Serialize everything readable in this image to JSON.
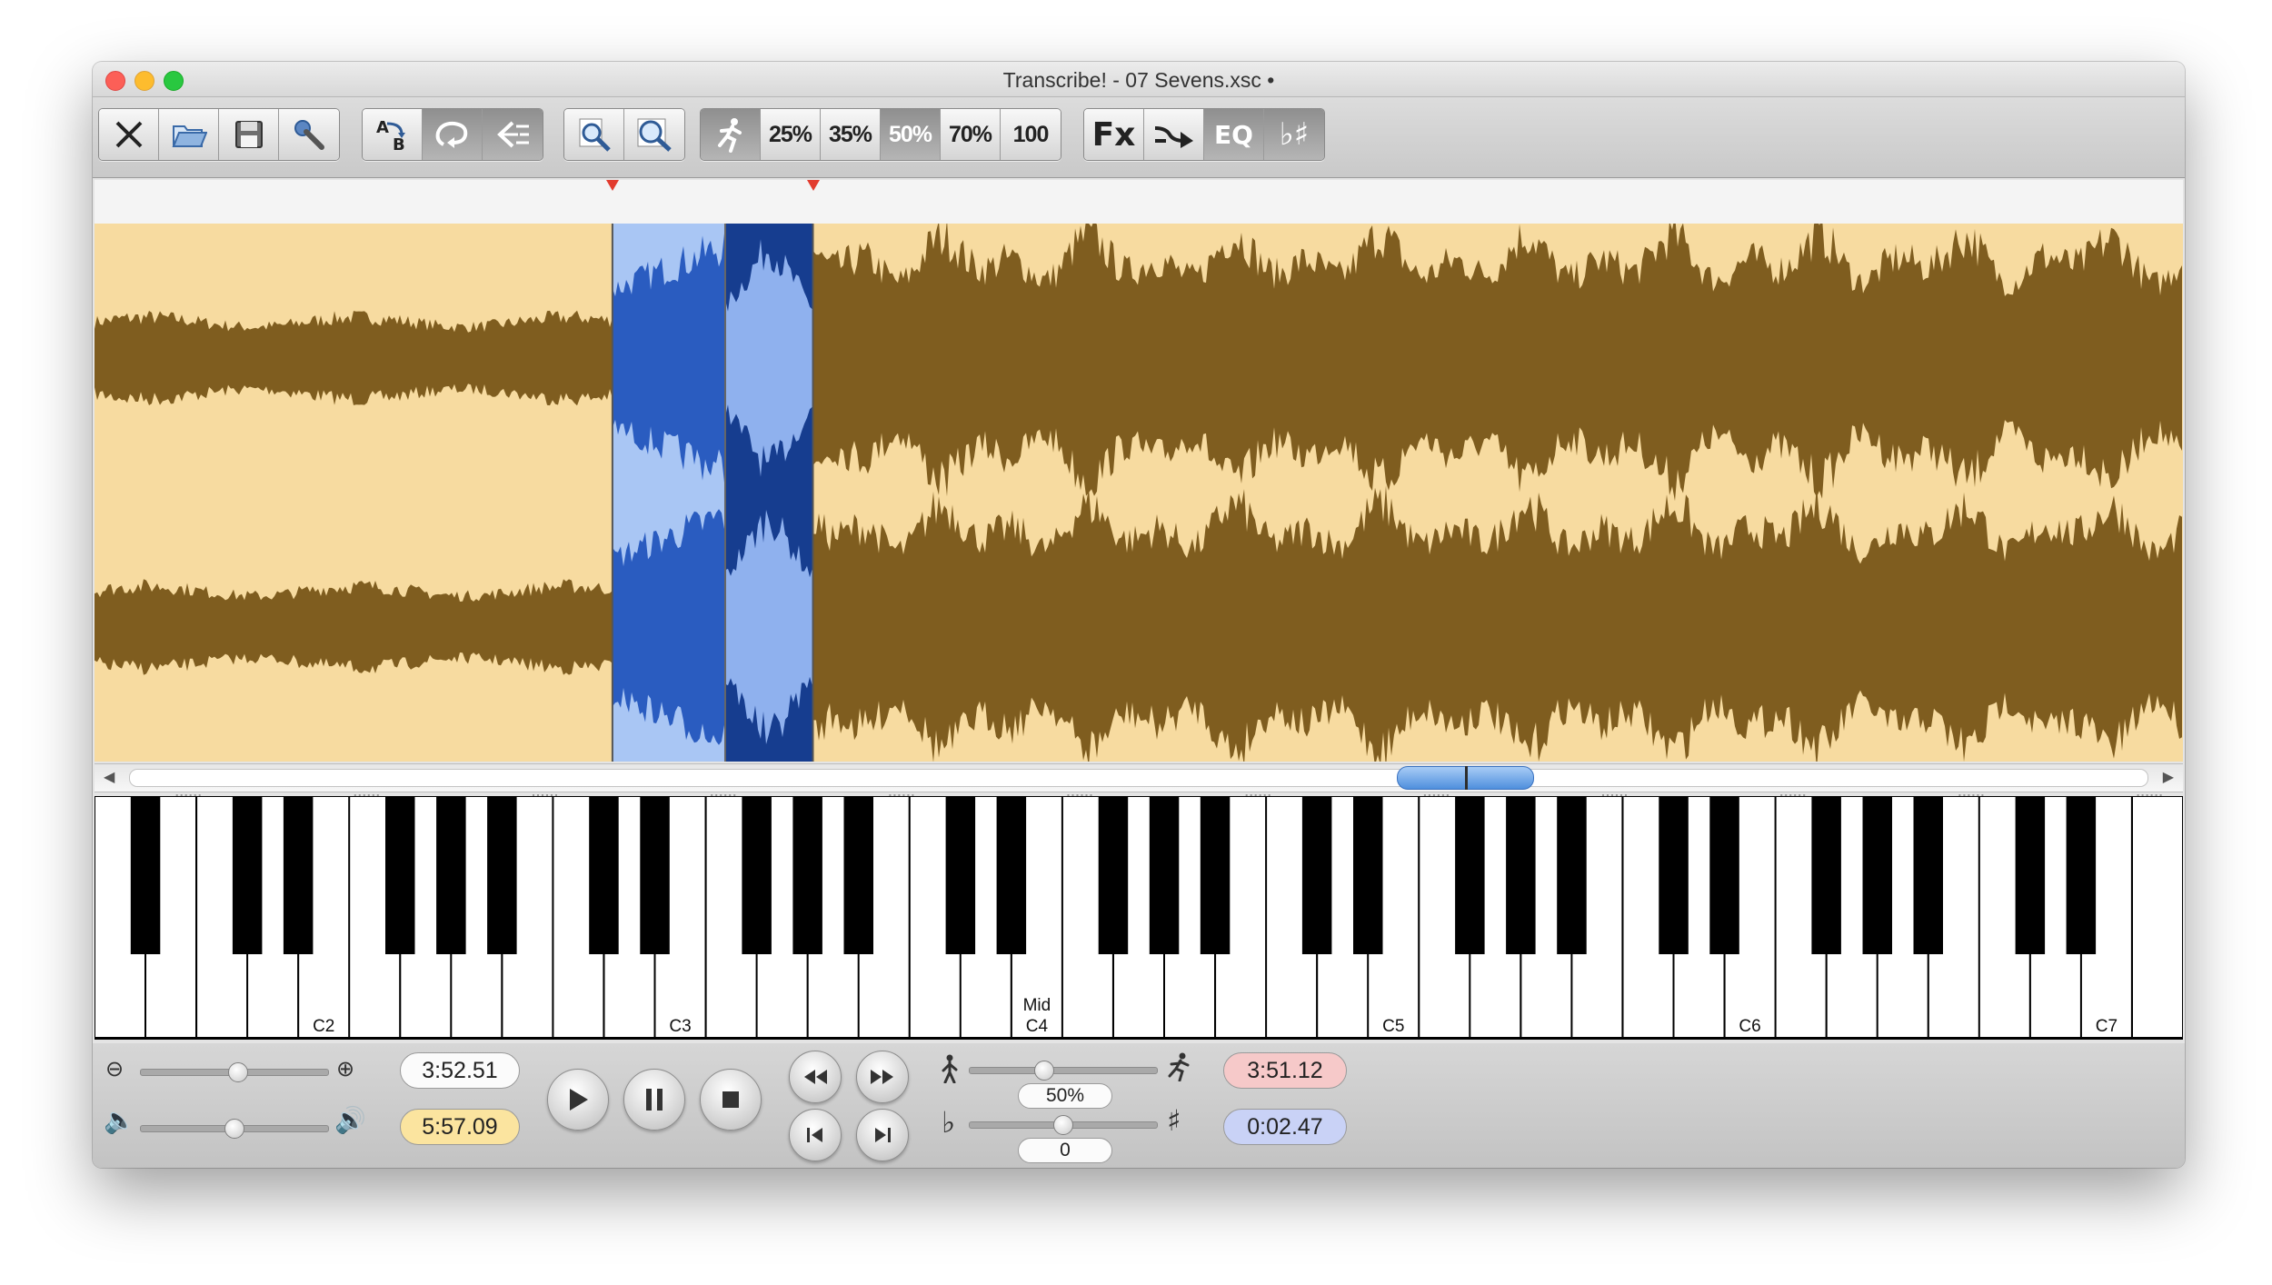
{
  "window": {
    "title": "Transcribe! - 07 Sevens.xsc •"
  },
  "toolbar": {
    "file_group": [
      {
        "name": "close-file-button",
        "icon": "close-x-icon"
      },
      {
        "name": "open-file-button",
        "icon": "folder-open-icon"
      },
      {
        "name": "save-file-button",
        "icon": "floppy-disk-icon"
      },
      {
        "name": "preferences-button",
        "icon": "wrench-icon"
      }
    ],
    "loop_group": [
      {
        "name": "ab-loop-button",
        "icon": "ab-icon"
      },
      {
        "name": "loop-button",
        "icon": "loop-icon"
      },
      {
        "name": "return-to-start-button",
        "icon": "arrow-left-bar-icon"
      }
    ],
    "zoom_group": [
      {
        "name": "zoom-in-button",
        "icon": "magnifier-plus-icon"
      },
      {
        "name": "zoom-fit-button",
        "icon": "magnifier-rect-icon"
      }
    ],
    "speed_group": {
      "icon": "running-man-icon",
      "presets": [
        "25%",
        "35%",
        "50%",
        "70%",
        "100"
      ],
      "active": "50%"
    },
    "fx_group": {
      "fx_label": "Fx",
      "eq_label": "EQ",
      "icons": [
        "tempo-arrow-icon",
        "flat-sharp-icon"
      ]
    }
  },
  "selection": {
    "start_fraction": 0.248,
    "end_fraction": 0.344,
    "playhead_fraction": 0.302
  },
  "scrollbar": {
    "thumb_start_fraction": 0.628,
    "thumb_end_fraction": 0.695
  },
  "keyboard": {
    "labels": [
      {
        "text": "C2",
        "white_index": 4
      },
      {
        "text": "C3",
        "white_index": 11
      },
      {
        "text": "Mid",
        "text2": "C4",
        "white_index": 18
      },
      {
        "text": "C5",
        "white_index": 25
      },
      {
        "text": "C6",
        "white_index": 32
      },
      {
        "text": "C7",
        "white_index": 39
      }
    ],
    "white_key_count": 41
  },
  "controls": {
    "zoom_slider": {
      "value": 0.52,
      "minus_icon": "zoom-out-icon",
      "plus_icon": "zoom-in-icon"
    },
    "volume_slider": {
      "value": 0.5,
      "low_icon": "speaker-low-icon",
      "high_icon": "speaker-high-icon"
    },
    "current_time": "3:52.51",
    "total_time": "5:57.09",
    "transport": [
      "play-button",
      "pause-button",
      "stop-button"
    ],
    "nav": [
      "rewind-button",
      "fast-forward-button",
      "skip-to-start-button",
      "skip-to-end-button"
    ],
    "speed": {
      "value_label": "50%",
      "slider": 0.4,
      "slow_icon": "walking-man-icon",
      "fast_icon": "running-man-icon"
    },
    "pitch": {
      "value_label": "0",
      "slider": 0.5,
      "flat": "♭",
      "sharp": "♯"
    },
    "selection_start": "3:51.12",
    "selection_length": "0:02.47"
  }
}
